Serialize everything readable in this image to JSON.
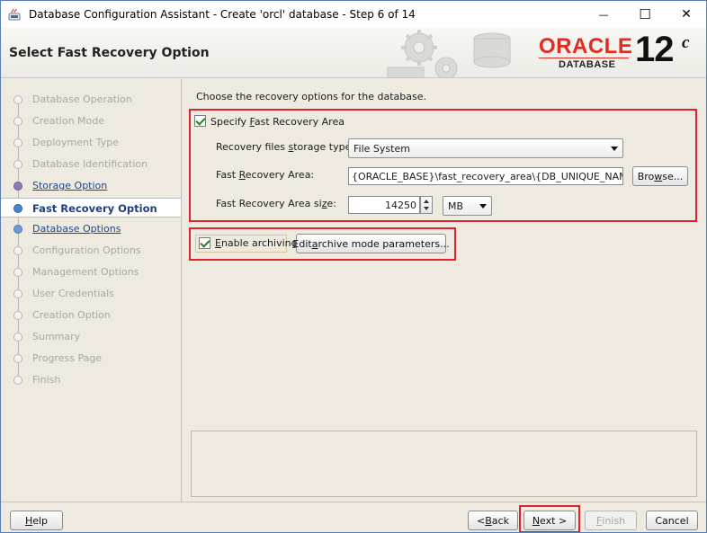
{
  "window": {
    "title": "Database Configuration Assistant - Create 'orcl' database - Step 6 of 14",
    "minimize_glyph": "—",
    "maximize_glyph": "☐",
    "close_glyph": "✕"
  },
  "banner": {
    "title": "Select Fast Recovery Option",
    "logo_text": "ORACLE",
    "logo_sub": "DATABASE",
    "version": "12",
    "version_suffix": "c"
  },
  "steps": [
    {
      "label": "Database Operation",
      "state": "pending"
    },
    {
      "label": "Creation Mode",
      "state": "pending"
    },
    {
      "label": "Deployment Type",
      "state": "pending"
    },
    {
      "label": "Database Identification",
      "state": "pending"
    },
    {
      "label": "Storage Option",
      "state": "visited"
    },
    {
      "label": "Fast Recovery Option",
      "state": "current"
    },
    {
      "label": "Database Options",
      "state": "next"
    },
    {
      "label": "Configuration Options",
      "state": "pending"
    },
    {
      "label": "Management Options",
      "state": "pending"
    },
    {
      "label": "User Credentials",
      "state": "pending"
    },
    {
      "label": "Creation Option",
      "state": "pending"
    },
    {
      "label": "Summary",
      "state": "pending"
    },
    {
      "label": "Progress Page",
      "state": "pending"
    },
    {
      "label": "Finish",
      "state": "pending"
    }
  ],
  "content": {
    "instruction": "Choose the recovery options for the database.",
    "fra": {
      "checkbox_label_pre": "Specify ",
      "checkbox_label_mnemonic": "F",
      "checkbox_label_post": "ast Recovery Area",
      "checked": true,
      "storage_type_label_pre": "Recovery files ",
      "storage_type_label_mnemonic": "s",
      "storage_type_label_post": "torage type:",
      "storage_type_value": "File System",
      "area_label_pre": "Fast ",
      "area_label_mnemonic": "R",
      "area_label_post": "ecovery Area:",
      "area_value": "{ORACLE_BASE}\\fast_recovery_area\\{DB_UNIQUE_NAME}",
      "browse_pre": "Bro",
      "browse_mnemonic": "w",
      "browse_post": "se...",
      "size_label_pre": "Fast Recovery Area si",
      "size_label_mnemonic": "z",
      "size_label_post": "e:",
      "size_value": "14250",
      "size_unit": "MB"
    },
    "archiving": {
      "checkbox_label_pre": "",
      "checkbox_label_mnemonic": "E",
      "checkbox_label_post": "nable archiving",
      "checked": true,
      "edit_pre": "Edit ",
      "edit_mnemonic": "a",
      "edit_post": "rchive mode parameters..."
    }
  },
  "footer": {
    "help_pre": "",
    "help_mnemonic": "H",
    "help_post": "elp",
    "back_pre": "< ",
    "back_mnemonic": "B",
    "back_post": "ack",
    "next_pre": "",
    "next_mnemonic": "N",
    "next_post": "ext >",
    "finish_pre": "",
    "finish_mnemonic": "F",
    "finish_post": "inish",
    "cancel_label": "Cancel"
  },
  "colors": {
    "highlight_red": "#e0222c",
    "oracle_red": "#e32b22",
    "current_step_text": "#1f3f7f",
    "link_text": "#24458e"
  }
}
